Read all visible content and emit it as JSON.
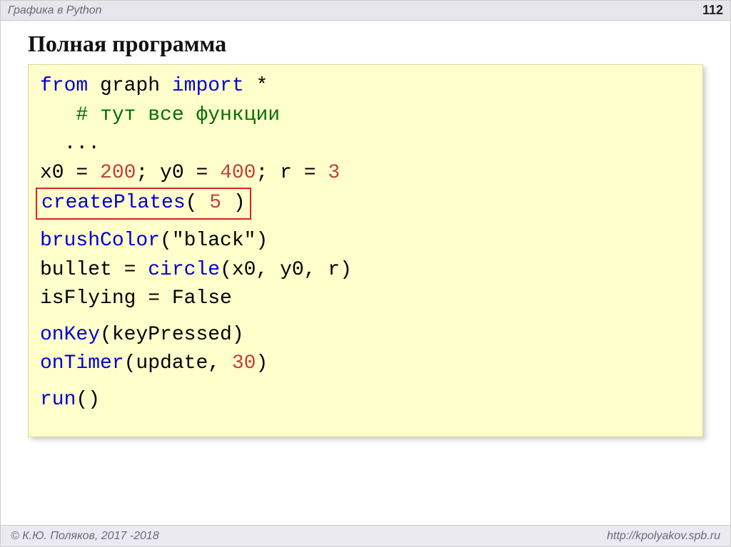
{
  "header": {
    "topic": "Графика в Python",
    "page": "112"
  },
  "title": "Полная программа",
  "code": {
    "l1_from": "from",
    "l1_mod": " graph ",
    "l1_import": "import",
    "l1_star": " *",
    "l2_indent": "   ",
    "l2_comment": "# тут все функции",
    "l3_indent": "  ",
    "l3_dots": "...",
    "l4_a": "x0 = ",
    "l4_n1": "200",
    "l4_b": "; y0 = ",
    "l4_n2": "400",
    "l4_c": "; r = ",
    "l4_n3": "3",
    "l5_fn": "createPlates",
    "l5_open": "( ",
    "l5_arg": "5",
    "l5_close": " )",
    "l6_fn": "brushColor",
    "l6_open": "(",
    "l6_arg": "\"black\"",
    "l6_close": ")",
    "l7_a": "bullet = ",
    "l7_fn": "circle",
    "l7_rest": "(x0, y0, r)",
    "l8": "isFlying = False",
    "l9_fn": "onKey",
    "l9_rest": "(keyPressed)",
    "l10_fn": "onTimer",
    "l10_open": "(update, ",
    "l10_n": "30",
    "l10_close": ")",
    "l11_fn": "run",
    "l11_rest": "()"
  },
  "footer": {
    "left": "© К.Ю. Поляков, 2017 -2018",
    "right": "http://kpolyakov.spb.ru"
  }
}
